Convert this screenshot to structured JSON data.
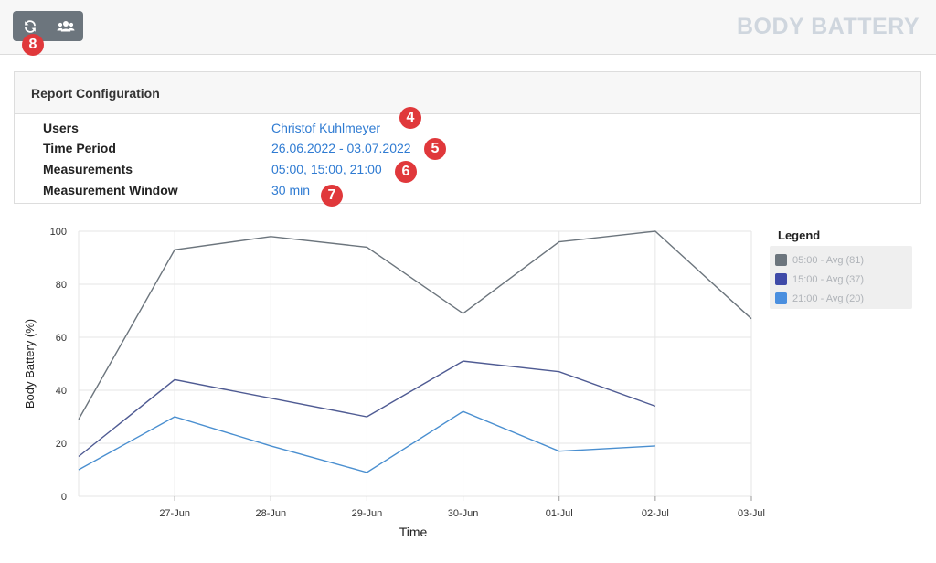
{
  "header": {
    "app_title": "BODY BATTERY",
    "buttons": [
      {
        "icon": "refresh-icon"
      },
      {
        "icon": "users-icon"
      }
    ]
  },
  "annotations": {
    "refresh": "8",
    "users": "4",
    "time_period": "5",
    "measurements": "6",
    "window": "7"
  },
  "report": {
    "title": "Report Configuration",
    "rows": [
      {
        "label": "Users",
        "value": "Christof Kuhlmeyer"
      },
      {
        "label": "Time Period",
        "value": "26.06.2022 - 03.07.2022"
      },
      {
        "label": "Measurements",
        "value": "05:00, 15:00, 21:00"
      },
      {
        "label": "Measurement Window",
        "value": "30 min"
      }
    ]
  },
  "legend": {
    "title": "Legend",
    "items": [
      {
        "label": "05:00 - Avg (81)",
        "color": "#6c757d"
      },
      {
        "label": "15:00 - Avg (37)",
        "color": "#3f4ba8"
      },
      {
        "label": "21:00 - Avg (20)",
        "color": "#4a8fdf"
      }
    ]
  },
  "chart_data": {
    "type": "line",
    "xlabel": "Time",
    "ylabel": "Body Battery (%)",
    "ylim": [
      0,
      100
    ],
    "yticks": [
      0,
      20,
      40,
      60,
      80,
      100
    ],
    "xlim": [
      "2022-06-26",
      "2022-07-03"
    ],
    "x_tick_labels": [
      "27-Jun",
      "28-Jun",
      "29-Jun",
      "30-Jun",
      "01-Jul",
      "02-Jul",
      "03-Jul"
    ],
    "grid": true,
    "series": [
      {
        "name": "05:00 - Avg (81)",
        "color": "#6c757d",
        "x": [
          "2022-06-26",
          "2022-06-27",
          "2022-06-28",
          "2022-06-29",
          "2022-06-30",
          "2022-07-01",
          "2022-07-02",
          "2022-07-03"
        ],
        "y": [
          29,
          93,
          98,
          94,
          69,
          96,
          100,
          67
        ]
      },
      {
        "name": "15:00 - Avg (37)",
        "color": "#4f5b93",
        "x": [
          "2022-06-26",
          "2022-06-27",
          "2022-06-28",
          "2022-06-29",
          "2022-06-30",
          "2022-07-01",
          "2022-07-02"
        ],
        "y": [
          15,
          44,
          37,
          30,
          51,
          47,
          34
        ]
      },
      {
        "name": "21:00 - Avg (20)",
        "color": "#4a8fd0",
        "x": [
          "2022-06-26",
          "2022-06-27",
          "2022-06-28",
          "2022-06-29",
          "2022-06-30",
          "2022-07-01",
          "2022-07-02"
        ],
        "y": [
          10,
          30,
          19,
          9,
          32,
          17,
          19
        ]
      }
    ]
  }
}
